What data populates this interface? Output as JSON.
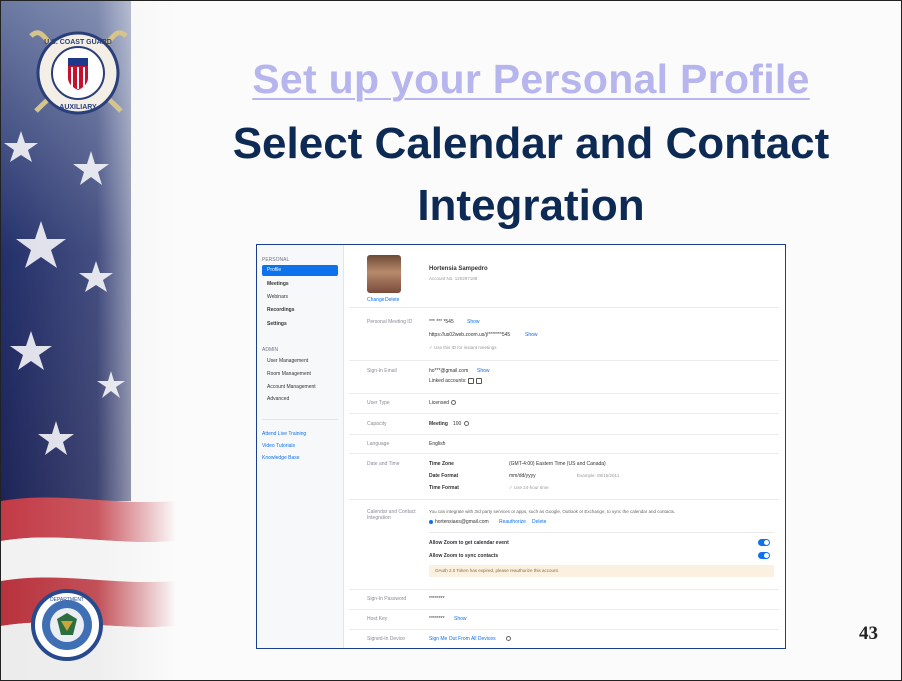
{
  "slide": {
    "title_line1": "Set up your Personal Profile",
    "title_line2a": "Select Calendar and Contact",
    "title_line2b": "Integration",
    "page_number": "43"
  },
  "sidebar": {
    "personal_header": "PERSONAL",
    "personal_items": [
      "Profile",
      "Meetings",
      "Webinars",
      "Recordings",
      "Settings"
    ],
    "admin_header": "ADMIN",
    "admin_items": [
      "User Management",
      "Room Management",
      "Account Management",
      "Advanced"
    ],
    "links": [
      "Attend Live Training",
      "Video Tutorials",
      "Knowledge Base"
    ]
  },
  "profile": {
    "name": "Hortensia Sampedro",
    "account_no": "Account No. 120297188",
    "change_label": "Change",
    "delete_label": "Delete"
  },
  "pmi": {
    "label": "Personal Meeting ID",
    "id_masked": "*** *** *545",
    "show": "Show",
    "url_masked": "https://us02web.zoom.us/j/*******545",
    "show2": "Show",
    "hint": "✓ Use this ID for instant meetings"
  },
  "signin_email": {
    "label": "Sign-In Email",
    "email_masked": "ho***@gmail.com",
    "show": "Show",
    "linked": "Linked accounts:"
  },
  "user_type": {
    "label": "User Type",
    "value": "Licensed"
  },
  "capacity": {
    "label": "Capacity",
    "meeting": "Meeting",
    "value": "100"
  },
  "language": {
    "label": "Language",
    "value": "English"
  },
  "date_time": {
    "label": "Date and Time",
    "tz_label": "Time Zone",
    "tz_value": "(GMT-4:00) Eastern Time (US and Canada)",
    "df_label": "Date Format",
    "df_value": "mm/dd/yyyy",
    "df_example": "Example: 08/15/2011",
    "tf_label": "Time Format",
    "tf_value": "✓ Use 24-hour time"
  },
  "calendar": {
    "label": "Calendar and Contact Integration",
    "desc": "You can integrate with 3rd party services or apps, such as Google, Outlook or Exchange, to sync the calendar and contacts.",
    "account": "hortensiaes@gmail.com",
    "reauthorize": "Reauthorize",
    "delete": "Delete",
    "toggle1": "Allow Zoom to get calendar event",
    "toggle2": "Allow Zoom to sync contacts",
    "notice": "OAuth 2.0 Token has expired, please reauthorize this account."
  },
  "signin_password": {
    "label": "Sign-In Password",
    "value": "********"
  },
  "host_key": {
    "label": "Host Key",
    "value": "********",
    "show": "Show"
  },
  "signed_in_device": {
    "label": "Signed-In Device",
    "link": "Sign Me Out From All Devices"
  },
  "colors": {
    "accent": "#0e72ed",
    "title_light": "#b7b5ee",
    "title_dark": "#0d2a55",
    "frame": "#1b3f8f"
  },
  "icons": [
    "uscg-auxiliary-seal",
    "dhs-seal",
    "star-icon",
    "info-icon",
    "toggle-on-icon"
  ]
}
